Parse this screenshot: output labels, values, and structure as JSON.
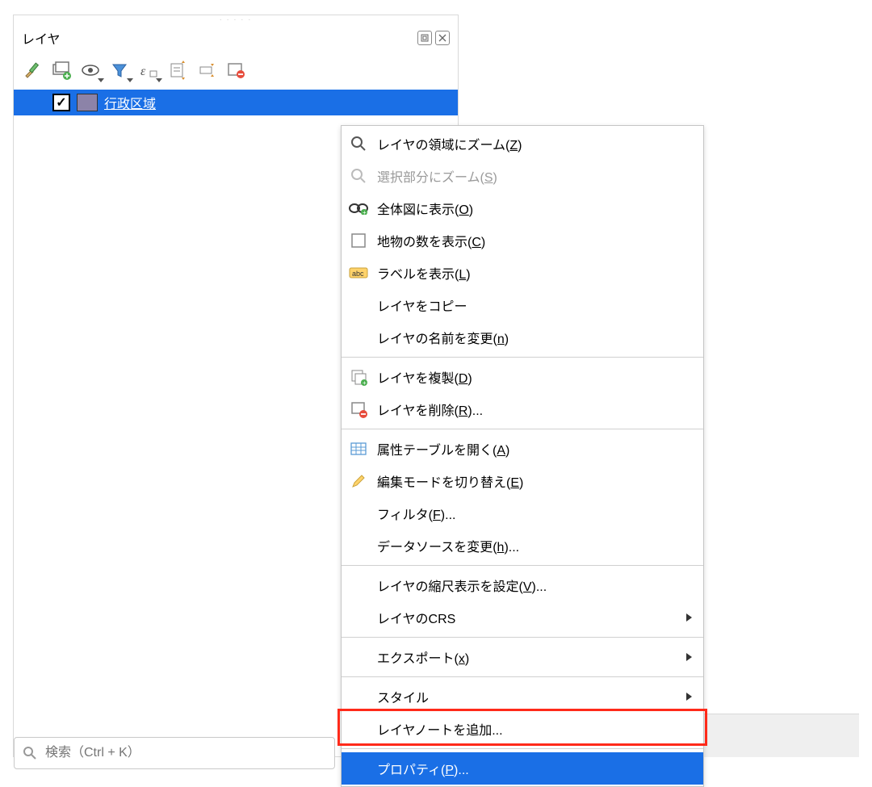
{
  "panel": {
    "title": "レイヤ",
    "drag_dots": "· · · · ·"
  },
  "toolbar": {
    "items": [
      {
        "name": "style-brush"
      },
      {
        "name": "add-group"
      },
      {
        "name": "manage-visibility"
      },
      {
        "name": "filter-legend"
      },
      {
        "name": "expression-filter"
      },
      {
        "name": "expand-all"
      },
      {
        "name": "collapse-all"
      },
      {
        "name": "remove-layer"
      }
    ]
  },
  "layer": {
    "name": "行政区域",
    "checked": true,
    "swatch": "#8c83a8"
  },
  "search": {
    "placeholder": "検索（Ctrl + K）"
  },
  "menu": {
    "items": [
      {
        "icon": "zoom",
        "label_pre": "レイヤの領域にズーム(",
        "ul": "Z",
        "label_post": ")",
        "disabled": false
      },
      {
        "icon": "zoom-gray",
        "label_pre": "選択部分にズーム(",
        "ul": "S",
        "label_post": ")",
        "disabled": true
      },
      {
        "icon": "overview",
        "label_pre": "全体図に表示(",
        "ul": "O",
        "label_post": ")",
        "disabled": false
      },
      {
        "icon": "checkbox",
        "label_pre": "地物の数を表示(",
        "ul": "C",
        "label_post": ")",
        "disabled": false
      },
      {
        "icon": "labels",
        "label_pre": "ラベルを表示(",
        "ul": "L",
        "label_post": ")",
        "disabled": false
      },
      {
        "icon": "",
        "label_pre": "レイヤをコピー",
        "ul": "",
        "label_post": "",
        "disabled": false
      },
      {
        "icon": "",
        "label_pre": "レイヤの名前を変更(",
        "ul": "n",
        "label_post": ")",
        "disabled": false
      },
      {
        "sep": true
      },
      {
        "icon": "duplicate",
        "label_pre": "レイヤを複製(",
        "ul": "D",
        "label_post": ")",
        "disabled": false
      },
      {
        "icon": "remove",
        "label_pre": "レイヤを削除(",
        "ul": "R",
        "label_post": ")...",
        "disabled": false
      },
      {
        "sep": true
      },
      {
        "icon": "table",
        "label_pre": "属性テーブルを開く(",
        "ul": "A",
        "label_post": ")",
        "disabled": false
      },
      {
        "icon": "pencil",
        "label_pre": "編集モードを切り替え(",
        "ul": "E",
        "label_post": ")",
        "disabled": false
      },
      {
        "icon": "",
        "label_pre": "フィルタ(",
        "ul": "F",
        "label_post": ")...",
        "disabled": false
      },
      {
        "icon": "",
        "label_pre": "データソースを変更(",
        "ul": "h",
        "label_post": ")...",
        "disabled": false
      },
      {
        "sep": true
      },
      {
        "icon": "",
        "label_pre": "レイヤの縮尺表示を設定(",
        "ul": "V",
        "label_post": ")...",
        "disabled": false
      },
      {
        "icon": "",
        "label_pre": "レイヤのCRS",
        "ul": "",
        "label_post": "",
        "submenu": true,
        "disabled": false
      },
      {
        "sep": true
      },
      {
        "icon": "",
        "label_pre": "エクスポート(",
        "ul": "x",
        "label_post": ")",
        "submenu": true,
        "disabled": false
      },
      {
        "sep": true
      },
      {
        "icon": "",
        "label_pre": "スタイル",
        "ul": "",
        "label_post": "",
        "submenu": true,
        "disabled": false
      },
      {
        "icon": "",
        "label_pre": "レイヤノートを追加...",
        "ul": "",
        "label_post": "",
        "disabled": false
      },
      {
        "sep": true
      },
      {
        "icon": "",
        "label_pre": "プロパティ(",
        "ul": "P",
        "label_post": ")...",
        "selected": true,
        "disabled": false
      }
    ]
  }
}
